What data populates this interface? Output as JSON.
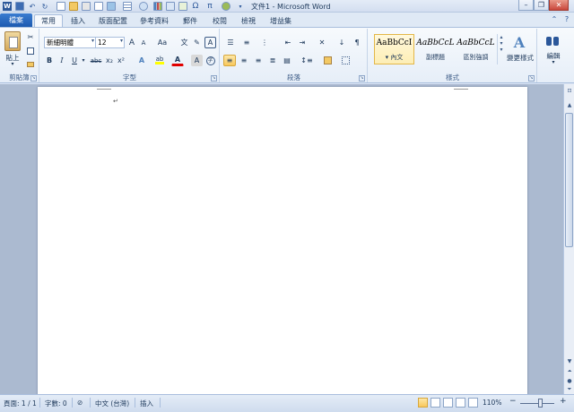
{
  "window": {
    "title": "文件1 - Microsoft Word",
    "min": "–",
    "restore": "❐",
    "close": "✕"
  },
  "qat": {
    "save": "💾",
    "undo": "↶",
    "redo": "↻",
    "omega": "Ω",
    "pi": "π"
  },
  "tabs": {
    "file": "檔案",
    "items": [
      "常用",
      "插入",
      "版面配置",
      "參考資料",
      "郵件",
      "校閱",
      "檢視",
      "增益集"
    ],
    "active_index": 0
  },
  "ribbon": {
    "clipboard": {
      "label": "剪貼簿",
      "paste": "貼上",
      "launcher": "↘"
    },
    "font": {
      "label": "字型",
      "font_name": "新細明體",
      "font_size": "12",
      "grow": "A",
      "shrink": "A",
      "change_case": "Aa",
      "bold": "B",
      "italic": "I",
      "underline": "U",
      "strike": "abc",
      "subscript": "x₂",
      "superscript": "x²",
      "font_color": "A",
      "launcher": "↘"
    },
    "paragraph": {
      "label": "段落",
      "launcher": "↘"
    },
    "styles": {
      "label": "樣式",
      "items": [
        {
          "sample": "AaBbCcI",
          "name": "▾ 內文"
        },
        {
          "sample": "AaBbCcL",
          "name": "副標題"
        },
        {
          "sample": "AaBbCcL",
          "name": "區別強調"
        }
      ],
      "selected_index": 0,
      "change_styles": "變更樣式",
      "launcher": "↘"
    },
    "editing": {
      "label": "編輯"
    }
  },
  "document": {
    "para_mark": "↵"
  },
  "status": {
    "page": "頁面: 1 / 1",
    "words": "字數: 0",
    "language": "中文 (台灣)",
    "mode": "插入",
    "zoom": "110%",
    "zoom_minus": "−",
    "zoom_plus": "+",
    "zoom_fraction": 0.6
  },
  "colors": {
    "accent": "#2b579a",
    "file_tab": "#1d5bb0",
    "highlight": "#f8c85d"
  }
}
